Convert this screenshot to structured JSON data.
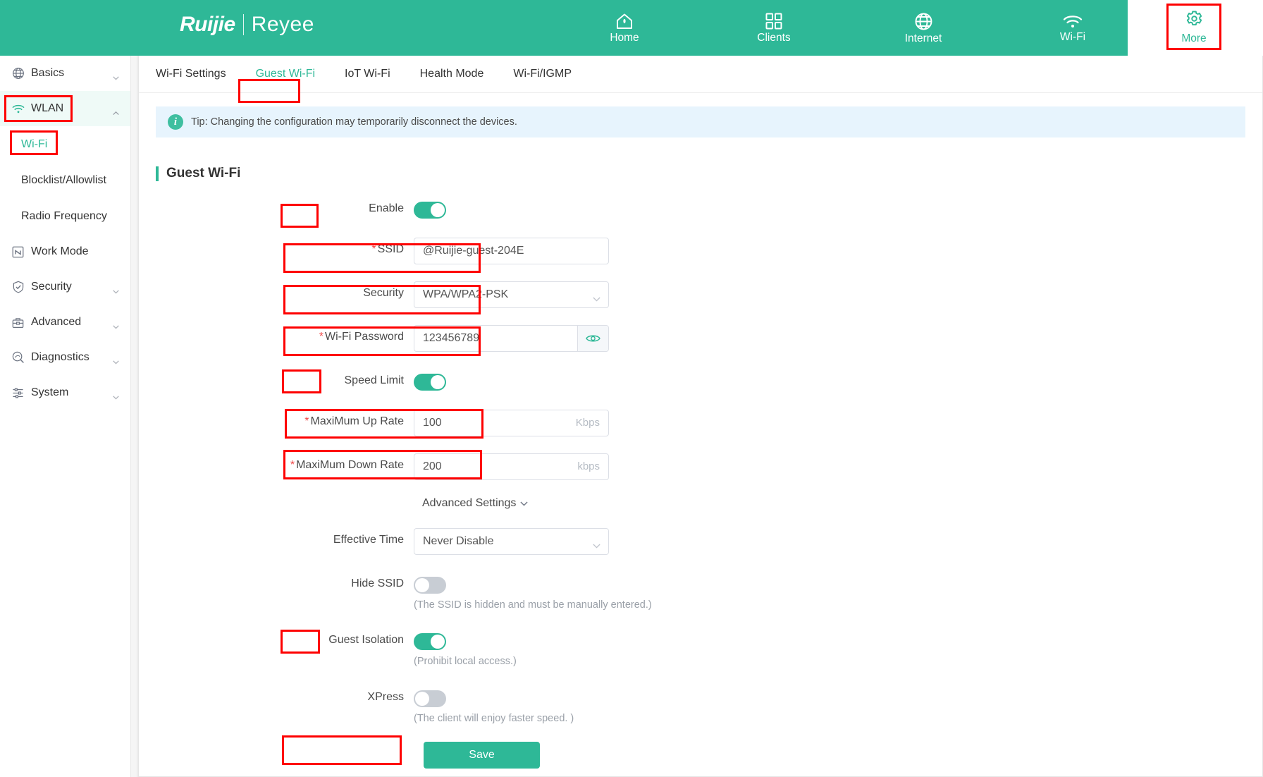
{
  "header": {
    "brand_primary": "Ruijie",
    "brand_secondary": "Reyee",
    "nav": [
      {
        "label": "Home",
        "icon": "home-icon"
      },
      {
        "label": "Clients",
        "icon": "clients-grid-icon"
      },
      {
        "label": "Internet",
        "icon": "globe-icon"
      },
      {
        "label": "Wi-Fi",
        "icon": "wifi-icon"
      }
    ],
    "more_label": "More",
    "more_icon": "gear-icon"
  },
  "sidebar": {
    "items": [
      {
        "label": "Basics",
        "icon": "globe-icon",
        "caret": "down",
        "type": "parent"
      },
      {
        "label": "WLAN",
        "icon": "wifi-icon",
        "caret": "up",
        "type": "parent",
        "expanded": true
      },
      {
        "label": "Wi-Fi",
        "type": "child",
        "selected": true
      },
      {
        "label": "Blocklist/Allowlist",
        "type": "child"
      },
      {
        "label": "Radio Frequency",
        "type": "child"
      },
      {
        "label": "Work Mode",
        "icon": "workmode-icon",
        "type": "item"
      },
      {
        "label": "Security",
        "icon": "shield-check-icon",
        "caret": "down",
        "type": "parent"
      },
      {
        "label": "Advanced",
        "icon": "toolbox-icon",
        "caret": "down",
        "type": "parent"
      },
      {
        "label": "Diagnostics",
        "icon": "magnifier-icon",
        "caret": "down",
        "type": "parent"
      },
      {
        "label": "System",
        "icon": "sliders-icon",
        "caret": "down",
        "type": "parent"
      }
    ]
  },
  "tabs": [
    {
      "label": "Wi-Fi Settings",
      "selected": false
    },
    {
      "label": "Guest Wi-Fi",
      "selected": true
    },
    {
      "label": "IoT Wi-Fi",
      "selected": false
    },
    {
      "label": "Health Mode",
      "selected": false
    },
    {
      "label": "Wi-Fi/IGMP",
      "selected": false
    }
  ],
  "tip": {
    "icon": "info-icon",
    "text": "Tip: Changing the configuration may temporarily disconnect the devices."
  },
  "section": {
    "title": "Guest Wi-Fi"
  },
  "form": {
    "enable": {
      "label": "Enable",
      "state": "on"
    },
    "ssid": {
      "label": "SSID",
      "required": true,
      "value": "@Ruijie-guest-204E"
    },
    "security": {
      "label": "Security",
      "required": false,
      "value": "WPA/WPA2-PSK"
    },
    "password": {
      "label": "Wi-Fi Password",
      "required": true,
      "value": "123456789",
      "eye_icon": "eye-icon"
    },
    "speed_limit": {
      "label": "Speed Limit",
      "state": "on"
    },
    "max_up_rate": {
      "label": "MaxiMum Up Rate",
      "required": true,
      "value": "100",
      "unit": "Kbps"
    },
    "max_down_rate": {
      "label": "MaxiMum Down Rate",
      "required": true,
      "value": "200",
      "unit": "kbps"
    },
    "advanced_settings": {
      "label": "Advanced Settings",
      "icon": "chevron-down-icon"
    },
    "effective_time": {
      "label": "Effective Time",
      "value": "Never Disable"
    },
    "hide_ssid": {
      "label": "Hide SSID",
      "state": "off",
      "hint": "(The SSID is hidden and must be manually entered.)"
    },
    "guest_isolation": {
      "label": "Guest Isolation",
      "state": "on",
      "hint": "(Prohibit local access.)"
    },
    "xpress": {
      "label": "XPress",
      "state": "off",
      "hint": "(The client will enjoy faster speed. )"
    },
    "save_label": "Save"
  },
  "colors": {
    "brand_teal": "#2eb897",
    "highlight_red": "#fe0000",
    "tip_bg": "#e7f4fd",
    "sidebar_active_bg": "#effaf7"
  }
}
